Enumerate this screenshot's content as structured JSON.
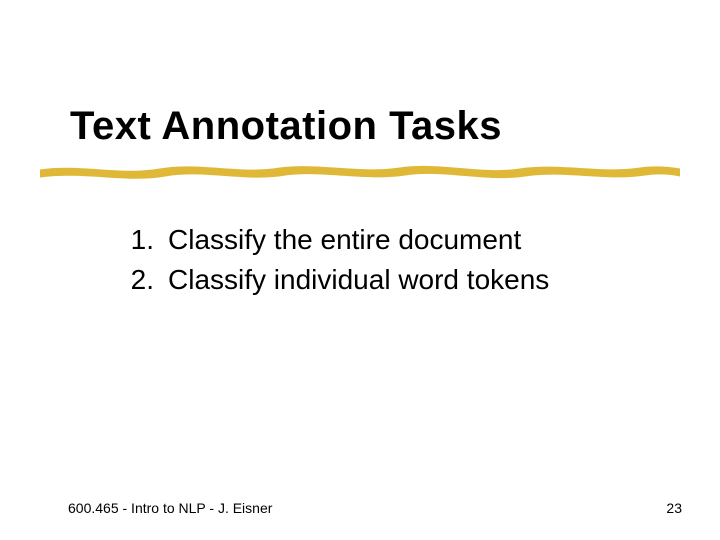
{
  "slide": {
    "title": "Text Annotation Tasks",
    "items": [
      {
        "num": "1.",
        "text": "Classify the entire document"
      },
      {
        "num": "2.",
        "text": "Classify individual word tokens"
      }
    ],
    "footer_left": "600.465 - Intro to NLP - J. Eisner",
    "page_number": "23"
  }
}
